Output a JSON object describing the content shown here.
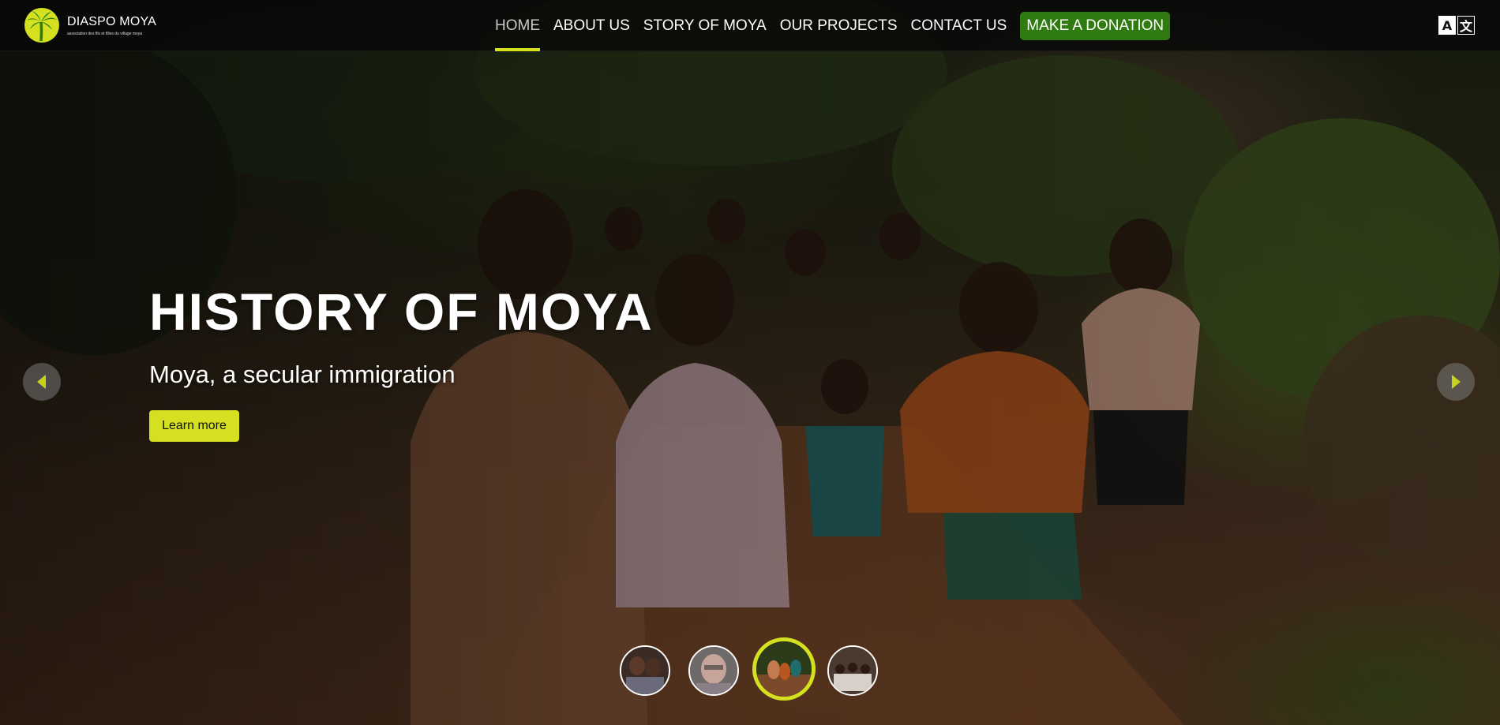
{
  "brand": {
    "name": "DIASPO MOYA",
    "tagline": "association des fils et filles du village moya",
    "logo_icon": "palm-tree-logo-icon"
  },
  "nav": {
    "items": [
      {
        "label": "HOME",
        "active": true
      },
      {
        "label": "ABOUT US",
        "active": false
      },
      {
        "label": "STORY OF MOYA",
        "active": false
      },
      {
        "label": "OUR PROJECTS",
        "active": false
      },
      {
        "label": "CONTACT US",
        "active": false
      }
    ],
    "donate_label": "MAKE A DONATION",
    "translate_icon": "translate-icon"
  },
  "slide": {
    "title": "HISTORY OF MOYA",
    "subtitle": "Moya, a secular immigration",
    "cta_label": "Learn more",
    "current_index": 2,
    "count": 4
  },
  "controls": {
    "prev_icon": "chevron-left-icon",
    "next_icon": "chevron-right-icon"
  },
  "colors": {
    "accent": "#d4e020",
    "donate": "#2f7a11",
    "topbar": "#080808"
  }
}
